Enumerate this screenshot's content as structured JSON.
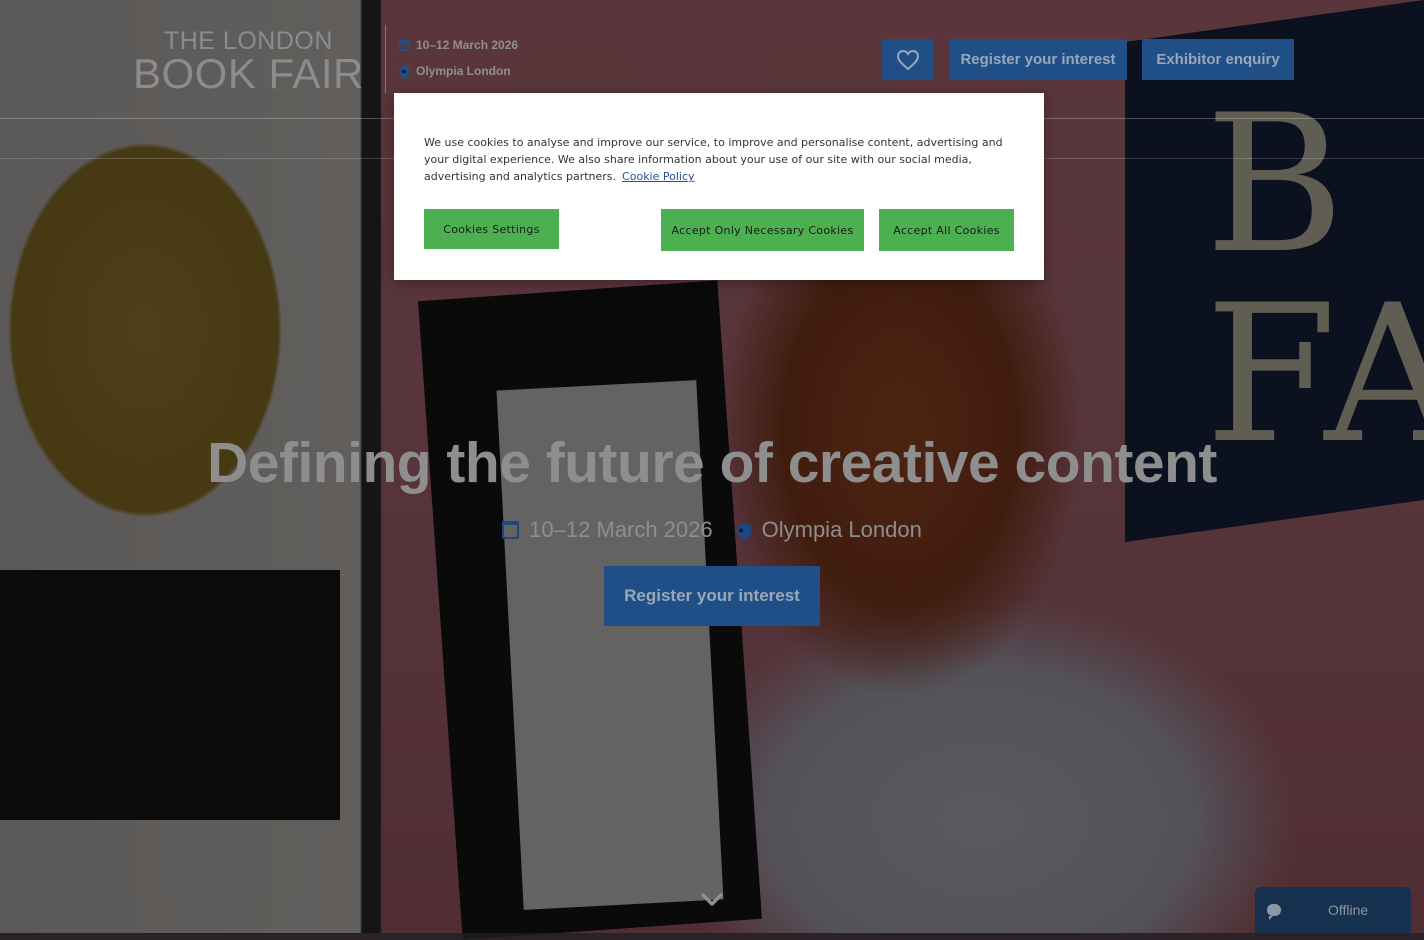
{
  "header": {
    "logo_top": "THE LONDON",
    "logo_bottom": "BOOK FAIR",
    "date": "10–12 March 2026",
    "venue": "Olympia London",
    "favourite_icon": "heart-icon",
    "register_label": "Register your interest",
    "exhibitor_label": "Exhibitor enquiry"
  },
  "hero": {
    "title": "Defining the future of creative content",
    "date": "10–12 March 2026",
    "venue": "Olympia London",
    "cta_label": "Register your interest",
    "scroll_icon": "chevron-down-icon"
  },
  "cookie_banner": {
    "text": "We use cookies to analyse and improve our service, to improve and personalise content, advertising and your digital experience. We also share information about your use of our site with our social media, advertising and analytics partners.",
    "policy_link": "Cookie Policy",
    "settings_label": "Cookies Settings",
    "necessary_label": "Accept Only Necessary Cookies",
    "accept_all_label": "Accept All Cookies",
    "button_color": "#4caf50"
  },
  "chat": {
    "status": "Offline",
    "icon": "chat-bubble-icon"
  },
  "colors": {
    "brand_blue": "#1f4f86",
    "chat_bg": "#16304f"
  }
}
